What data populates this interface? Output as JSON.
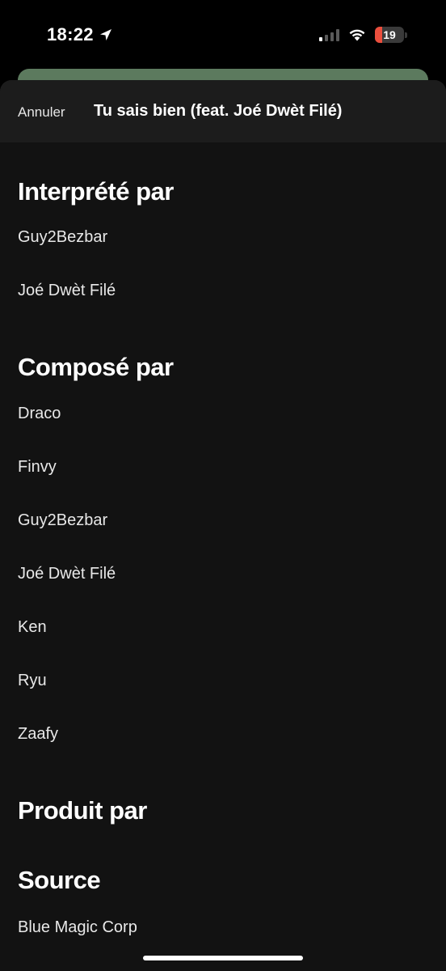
{
  "status_bar": {
    "time": "18:22",
    "battery": "19",
    "battery_color": "#eb4e3d"
  },
  "header": {
    "cancel_label": "Annuler",
    "title": "Tu sais bien (feat. Joé Dwèt Filé)"
  },
  "sections": {
    "performed": {
      "title": "Interprété par",
      "items": [
        "Guy2Bezbar",
        "Joé Dwèt Filé"
      ]
    },
    "composed": {
      "title": "Composé par",
      "items": [
        "Draco",
        "Finvy",
        "Guy2Bezbar",
        "Joé Dwèt Filé",
        "Ken",
        "Ryu",
        "Zaafy"
      ]
    },
    "produced": {
      "title": "Produit par"
    },
    "source": {
      "title": "Source",
      "items": [
        "Blue Magic Corp"
      ]
    }
  },
  "colors": {
    "background": "#000000",
    "sheet": "#121212",
    "header": "#1c1c1c",
    "accent_card": "#5c7a5e"
  }
}
